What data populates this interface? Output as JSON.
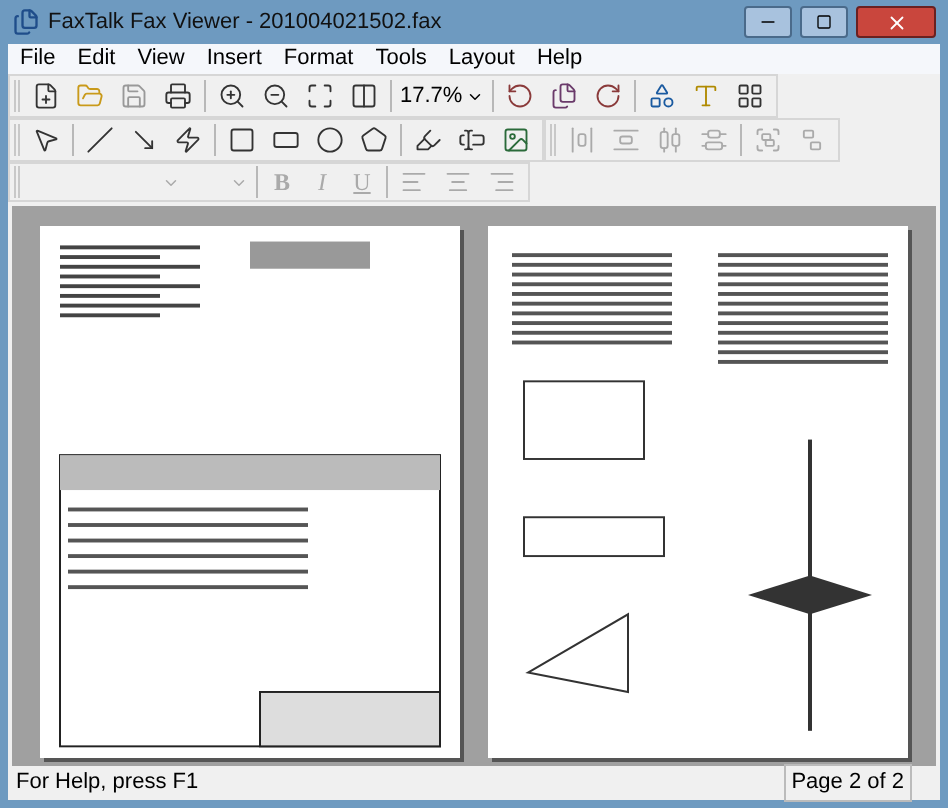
{
  "window": {
    "title": "FaxTalk Fax Viewer - 201004021502.fax"
  },
  "menu": [
    "File",
    "Edit",
    "View",
    "Insert",
    "Format",
    "Tools",
    "Layout",
    "Help"
  ],
  "zoom": {
    "value": "17.7%"
  },
  "format_buttons": [
    {
      "label": "B",
      "kind": "bold",
      "disabled": true
    },
    {
      "label": "I",
      "kind": "italic",
      "disabled": true
    },
    {
      "label": "U",
      "kind": "underline",
      "disabled": true
    }
  ],
  "status_bar": {
    "help": "For Help, press F1",
    "page": "Page 2 of 2"
  }
}
